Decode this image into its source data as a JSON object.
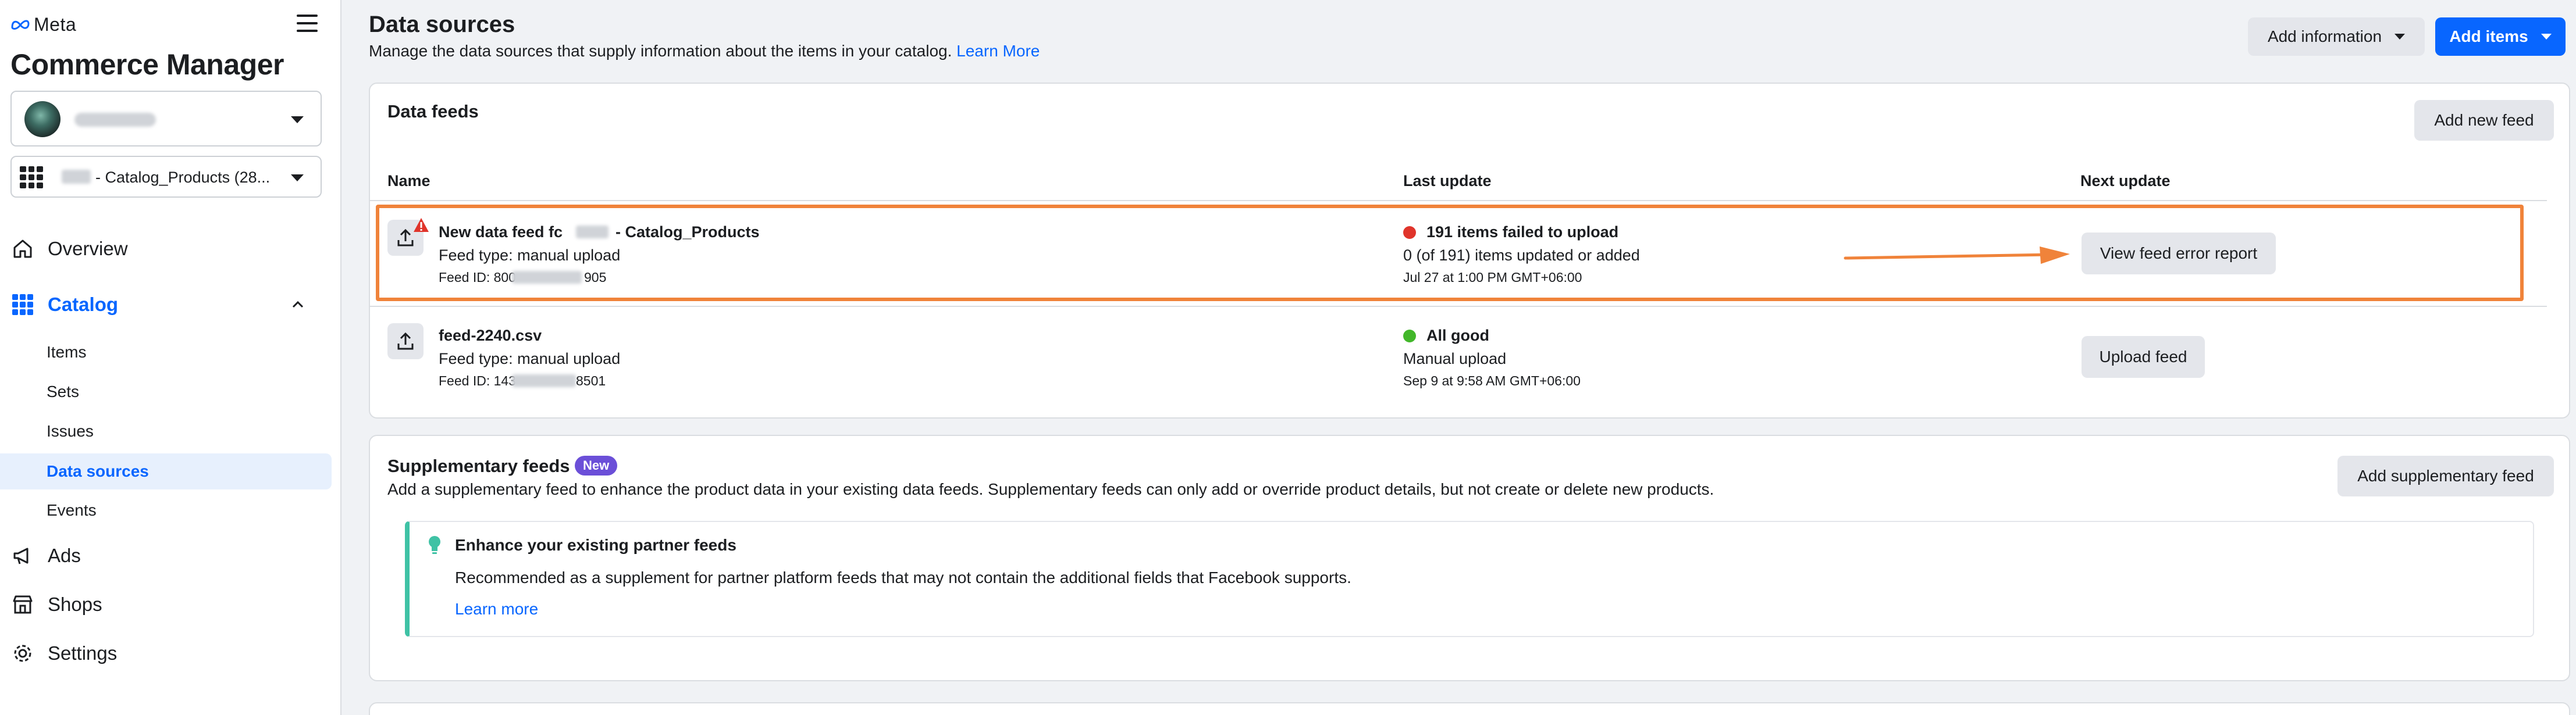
{
  "brand": {
    "meta_text": "Meta",
    "app_title": "Commerce Manager"
  },
  "sidebar": {
    "catalog_selector": "- Catalog_Products (28...",
    "nav": {
      "overview": "Overview",
      "catalog": "Catalog",
      "ads": "Ads",
      "shops": "Shops",
      "settings": "Settings"
    },
    "catalog_sub": {
      "items": "Items",
      "sets": "Sets",
      "issues": "Issues",
      "data_sources": "Data sources",
      "events": "Events"
    }
  },
  "header": {
    "title": "Data sources",
    "subtitle": "Manage the data sources that supply information about the items in your catalog.",
    "learn_more": "Learn More",
    "add_information": "Add information",
    "add_items": "Add items"
  },
  "data_feeds": {
    "title": "Data feeds",
    "add_new_feed": "Add new feed",
    "columns": {
      "name": "Name",
      "last_update": "Last update",
      "next_update": "Next update"
    },
    "rows": [
      {
        "name_prefix": "New data feed fc",
        "name_suffix": "- Catalog_Products",
        "type": "Feed type: manual upload",
        "id_prefix": "Feed ID: 800",
        "id_suffix": "905",
        "status": "191 items failed to upload",
        "status_color": "#e0342b",
        "detail": "0 (of 191) items updated or added",
        "time": "Jul 27 at 1:00 PM GMT+06:00",
        "action": "View feed error report"
      },
      {
        "name": "feed-2240.csv",
        "type": "Feed type: manual upload",
        "id_prefix": "Feed ID: 143",
        "id_suffix": "8501",
        "status": "All good",
        "status_color": "#42b72a",
        "detail": "Manual upload",
        "time": "Sep 9 at 9:58 AM GMT+06:00",
        "action": "Upload feed"
      }
    ]
  },
  "supplementary": {
    "title": "Supplementary feeds",
    "badge": "New",
    "description": "Add a supplementary feed to enhance the product data in your existing data feeds. Supplementary feeds can only add or override product details, but not create or delete new products.",
    "add_button": "Add supplementary feed",
    "tip": {
      "title": "Enhance your existing partner feeds",
      "text": "Recommended as a supplement for partner platform feeds that may not contain the additional fields that Facebook supports.",
      "link": "Learn more"
    }
  },
  "colors": {
    "accent": "#0866ff",
    "highlight": "#f0833a",
    "tip_border": "#3fc2a5",
    "badge": "#6b4fd8"
  }
}
